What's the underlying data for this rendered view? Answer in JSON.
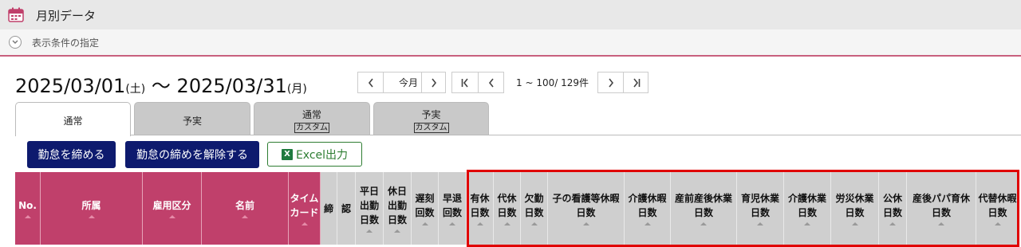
{
  "app": {
    "title": "月別データ"
  },
  "conditions": {
    "label": "表示条件の指定"
  },
  "period": {
    "start": "2025/03/01",
    "start_weekday": "(土)",
    "separator": "～",
    "end": "2025/03/31",
    "end_weekday": "(月)"
  },
  "navigation": {
    "this_month": "今月",
    "range": "1 ~ 100/ 129件"
  },
  "tabs": [
    {
      "label": "通常",
      "sub": ""
    },
    {
      "label": "予実",
      "sub": ""
    },
    {
      "label": "通常",
      "sub": "カスタム"
    },
    {
      "label": "予実",
      "sub": "カスタム"
    }
  ],
  "actions": {
    "close": "勤怠を締める",
    "unclose": "勤怠の締めを解除する",
    "excel": "Excel出力",
    "excel_icon_letter": "X"
  },
  "columns": [
    {
      "lines": [
        "No."
      ]
    },
    {
      "lines": [
        "所属"
      ]
    },
    {
      "lines": [
        "雇用区分"
      ]
    },
    {
      "lines": [
        "名前"
      ]
    },
    {
      "lines": [
        "タイム",
        "カード"
      ]
    },
    {
      "lines": [
        "締"
      ]
    },
    {
      "lines": [
        "認"
      ]
    },
    {
      "lines": [
        "平日",
        "出勤",
        "日数"
      ]
    },
    {
      "lines": [
        "休日",
        "出勤",
        "日数"
      ]
    },
    {
      "lines": [
        "遅刻",
        "回数"
      ]
    },
    {
      "lines": [
        "早退",
        "回数"
      ]
    },
    {
      "lines": [
        "有休",
        "日数"
      ]
    },
    {
      "lines": [
        "代休",
        "日数"
      ]
    },
    {
      "lines": [
        "欠勤",
        "日数"
      ]
    },
    {
      "lines": [
        "子の看護等休暇",
        "日数"
      ]
    },
    {
      "lines": [
        "介護休暇",
        "日数"
      ]
    },
    {
      "lines": [
        "産前産後休業",
        "日数"
      ]
    },
    {
      "lines": [
        "育児休業",
        "日数"
      ]
    },
    {
      "lines": [
        "介護休業",
        "日数"
      ]
    },
    {
      "lines": [
        "労災休業",
        "日数"
      ]
    },
    {
      "lines": [
        "公休",
        "日数"
      ]
    },
    {
      "lines": [
        "産後パパ育休",
        "日数"
      ]
    },
    {
      "lines": [
        "代替休暇",
        "日数"
      ]
    }
  ],
  "colors": {
    "header_pink": "#c0406b",
    "header_gray": "#cfcfcf",
    "button_navy": "#0d1a6e",
    "excel_green": "#2e7d32",
    "highlight_red": "#e00000"
  }
}
